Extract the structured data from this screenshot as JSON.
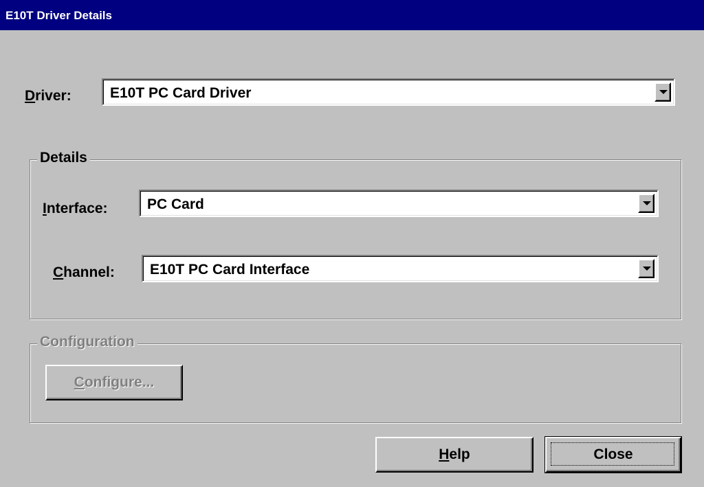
{
  "window": {
    "title": "E10T Driver Details"
  },
  "driver": {
    "label_accel": "D",
    "label_rest": "river:",
    "value": "E10T PC Card Driver"
  },
  "details_group": {
    "title": "Details",
    "interface": {
      "label_accel": "I",
      "label_rest": "nterface:",
      "value": "PC Card"
    },
    "channel": {
      "label_accel": "C",
      "label_rest": "hannel:",
      "value": "E10T PC Card Interface"
    }
  },
  "configuration_group": {
    "title": "Configuration",
    "configure_button": {
      "accel": "C",
      "rest": "onfigure...",
      "enabled": false
    }
  },
  "buttons": {
    "help": {
      "accel": "H",
      "rest": "elp"
    },
    "close": {
      "label": "Close"
    }
  },
  "colors": {
    "title_bar": "#000080",
    "face": "#c0c0c0",
    "disabled_text": "#808080"
  }
}
